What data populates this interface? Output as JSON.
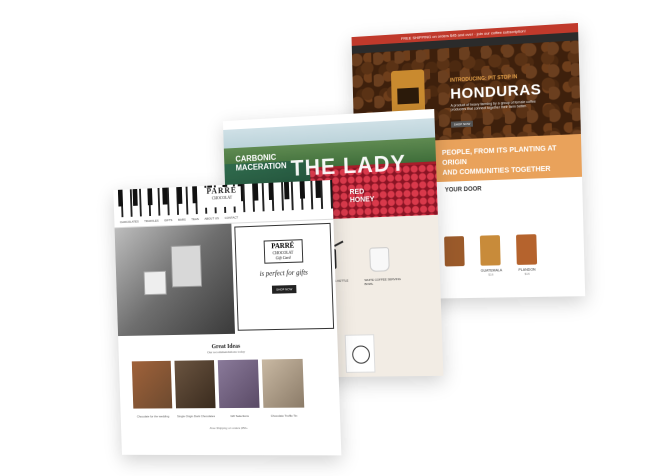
{
  "back_site": {
    "top_banner": "FREE SHIPPING on orders $45 and over · join our coffee subscription!",
    "hero": {
      "kicker": "INTRODUCING: PIT STOP IN",
      "title": "HONDURAS",
      "description": "A product of heavy farming by a group of female coffee producers that connect together their farm better.",
      "button": "SHOP NOW"
    },
    "band_text": "PEOPLE, FROM ITS PLANTING AT ORIGIN\nAND COMMUNITIES TOGETHER",
    "section_title": "YOUR DOOR",
    "products": [
      {
        "name": "",
        "price": "",
        "color": "#9b5a2a"
      },
      {
        "name": "GUATEMALA",
        "price": "$16",
        "color": "#c88b3a"
      },
      {
        "name": "PLANDON",
        "price": "$16",
        "color": "#b5632d"
      }
    ]
  },
  "mid_site": {
    "hero": {
      "headline": "CARBONIC\nMACERATION",
      "big_text": "THE LADY",
      "sub": "RED\nHONEY"
    },
    "products": [
      {
        "label": "STAGG EKG KETTLE"
      },
      {
        "label": "WHITE COFFEE SERVING BOWL"
      }
    ]
  },
  "front_site": {
    "logo": {
      "name": "PARRÉ",
      "sub": "CHOCOLAT"
    },
    "nav": [
      "CHOCOLATES",
      "TRUFFLES",
      "GIFTS",
      "BARS",
      "TEAS",
      "ABOUT US",
      "CONTACT"
    ],
    "badge": {
      "a": "PARRÉ",
      "b": "CHOCOLAT",
      "c": "Gift Card"
    },
    "tagline": "is perfect for gifts",
    "shop_button": "SHOP NOW",
    "ideas_title": "Great Ideas",
    "ideas_sub": "Our recommendations today",
    "tiles": [
      {
        "caption": "Chocolate for the wedding",
        "color": "#6d4a2f"
      },
      {
        "caption": "Single Origin Dark Chocolates",
        "color": "#3a2b1e"
      },
      {
        "caption": "Gift Selections",
        "color": "#5a4a66"
      },
      {
        "caption": "Chocolate Truffle Tin",
        "color": "#8b7b68"
      }
    ],
    "footer": "Free Shipping on orders $50+"
  }
}
